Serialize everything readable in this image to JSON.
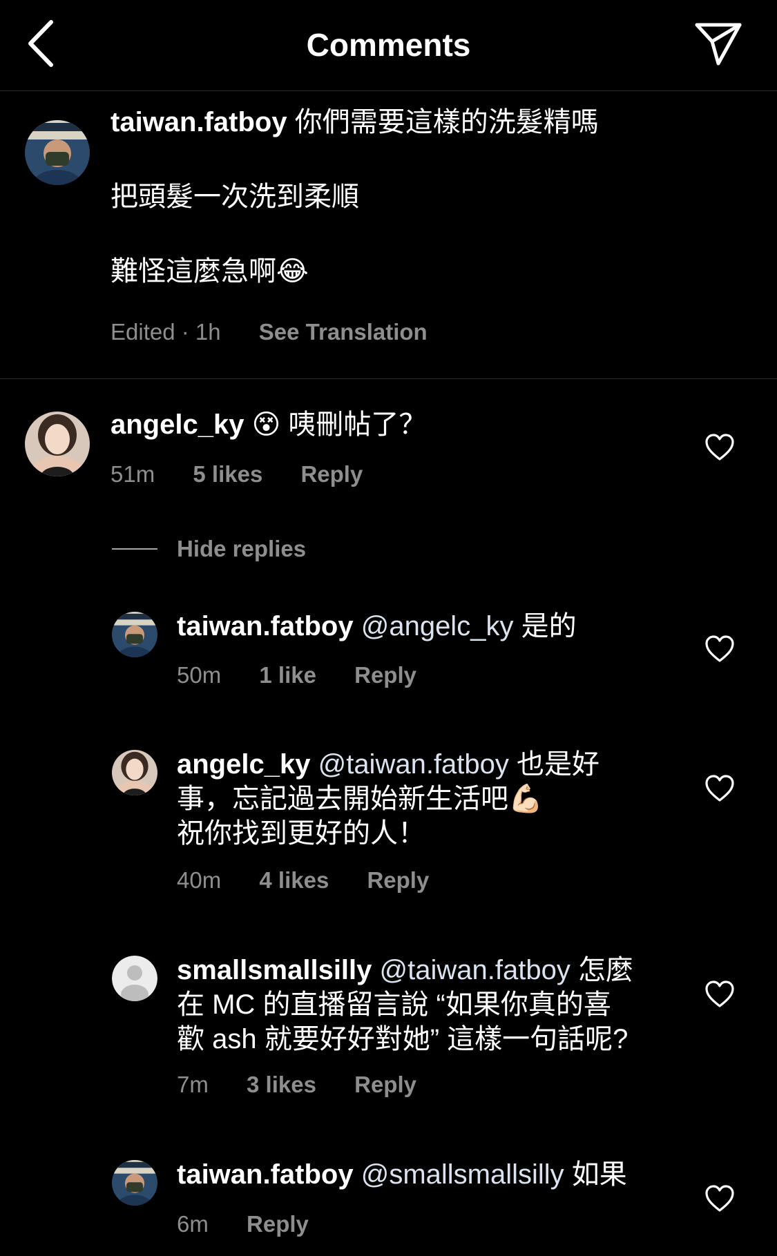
{
  "header": {
    "title": "Comments"
  },
  "caption": {
    "username": "taiwan.fatboy",
    "line1": "你們需要這樣的洗髮精嗎",
    "line2": "把頭髮一次洗到柔順",
    "line3": "難怪這麼急啊😂",
    "time": "Edited · 1h",
    "see_translation": "See Translation"
  },
  "comments": [
    {
      "username": "angelc_ky",
      "text": "😵 咦刪帖了？",
      "time": "51m",
      "likes": "5 likes",
      "reply": "Reply"
    }
  ],
  "hide_replies": "Hide replies",
  "replies": [
    {
      "username": "taiwan.fatboy",
      "mention": "@angelc_ky",
      "line1": " 是的",
      "time": "50m",
      "likes": "1 like",
      "reply": "Reply"
    },
    {
      "username": "angelc_ky",
      "mention": "@taiwan.fatboy",
      "line1": " 也是好",
      "line2": "事，忘記過去開始新生活吧💪🏻",
      "line3": "祝你找到更好的人！",
      "time": "40m",
      "likes": "4 likes",
      "reply": "Reply"
    },
    {
      "username": "smallsmallsilly",
      "mention": "@taiwan.fatboy",
      "line1": " 怎麼",
      "line2": "在 MC 的直播留言說 “如果你真的喜",
      "line3": "歡 ash 就要好好對她” 這樣一句話呢?",
      "time": "7m",
      "likes": "3 likes",
      "reply": "Reply"
    },
    {
      "username": "taiwan.fatboy",
      "mention": "@smallsmallsilly",
      "line1": " 如果",
      "time": "6m",
      "reply": "Reply"
    }
  ],
  "icons": {
    "back": "chevron-left-icon",
    "share": "paper-plane-icon",
    "like": "heart-outline-icon"
  }
}
